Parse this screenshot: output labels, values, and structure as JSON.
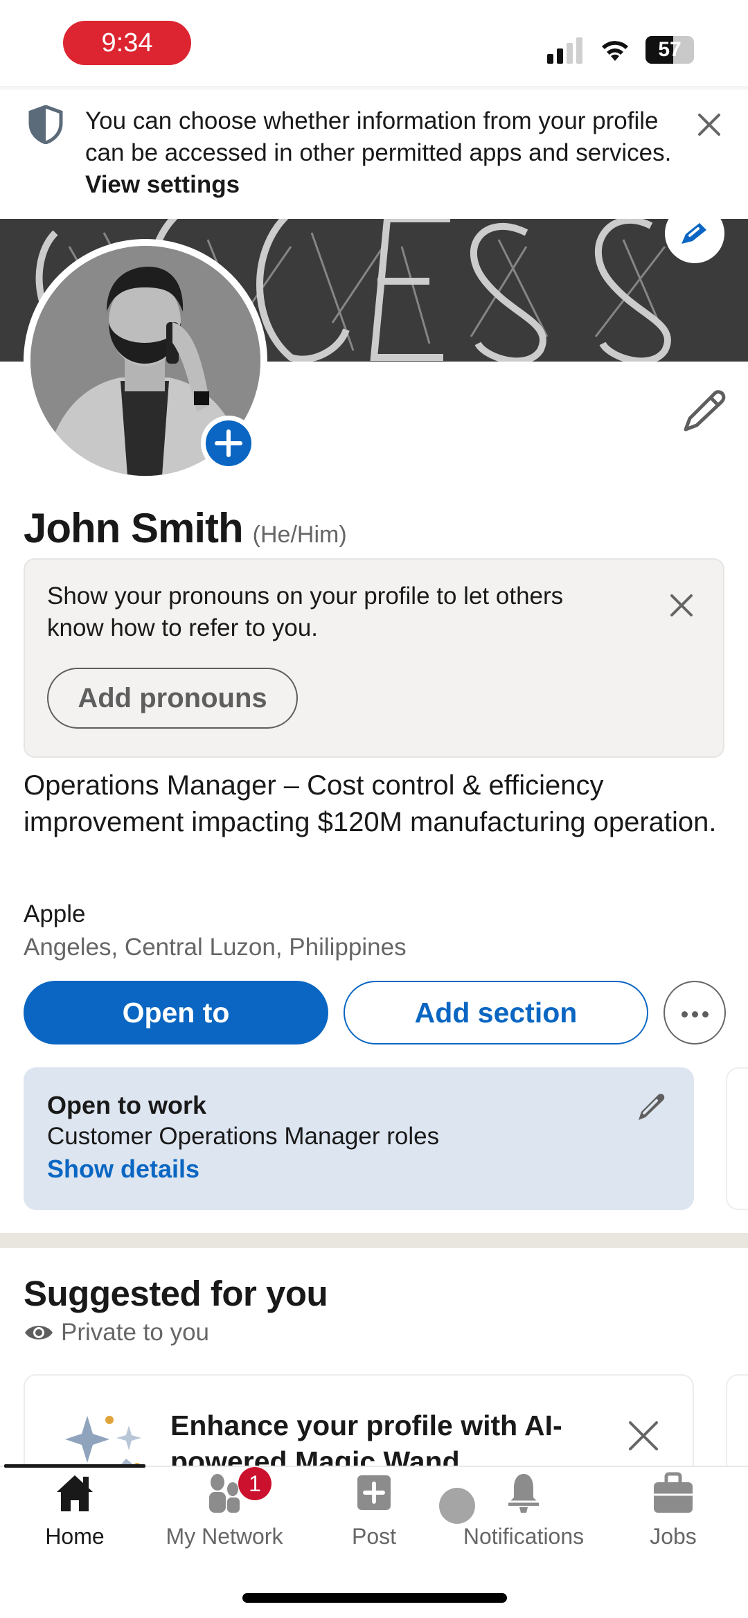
{
  "status_bar": {
    "time": "9:34",
    "battery_percent": "57",
    "battery_level": 0.57,
    "signal_bars_active": 2,
    "signal_bars_total": 4
  },
  "privacy_banner": {
    "text": "You can choose whether information from your profile can be accessed in other permitted apps and services.",
    "link": "View settings",
    "icon": "shield-icon",
    "close_icon": "close-icon"
  },
  "cover": {
    "image_description": "Chalkboard with the word SUCCESS drawn in chalk",
    "edit_icon": "pencil-icon"
  },
  "profile": {
    "avatar_description": "Black and white photo of a bearded man in a blazer talking on a phone",
    "add_photo_icon": "plus-icon",
    "edit_intro_icon": "pencil-icon",
    "name": "John Smith",
    "pronouns": "(He/Him)",
    "headline": "Operations Manager – Cost control & efficiency improvement impacting $120M manufacturing operation.",
    "company": "Apple",
    "location": "Angeles, Central Luzon, Philippines"
  },
  "pronoun_card": {
    "text": "Show your pronouns on your profile to let others know how to refer to you.",
    "button": "Add pronouns"
  },
  "actions": {
    "open_to": "Open to",
    "add_section": "Add section",
    "more_icon": "more-horizontal-icon"
  },
  "open_to_work": {
    "title": "Open to work",
    "subtitle": "Customer Operations Manager roles",
    "link": "Show details"
  },
  "suggested": {
    "title": "Suggested for you",
    "privacy_label": "Private to you",
    "card_text": "Enhance your profile with AI-powered Magic Wand"
  },
  "tabbar": {
    "tabs": [
      {
        "label": "Home",
        "icon": "home-icon",
        "active": true
      },
      {
        "label": "My Network",
        "icon": "network-icon",
        "badge": "1"
      },
      {
        "label": "Post",
        "icon": "post-icon"
      },
      {
        "label": "Notifications",
        "icon": "bell-icon"
      },
      {
        "label": "Jobs",
        "icon": "briefcase-icon"
      }
    ]
  },
  "colors": {
    "brand_blue": "#0a66c2",
    "badge_red": "#cb112d",
    "time_pill_red": "#dc2530",
    "open_to_work_bg": "#dde5f0"
  }
}
